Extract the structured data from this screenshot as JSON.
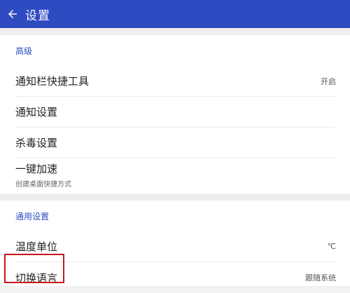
{
  "appbar": {
    "title": "设置",
    "back_icon": "arrow-left-icon",
    "color": "#2e4bc2"
  },
  "advanced": {
    "header": "高级",
    "items": [
      {
        "label": "通知栏快捷工具",
        "value": "开启"
      },
      {
        "label": "通知设置"
      },
      {
        "label": "杀毒设置"
      },
      {
        "label": "一键加速",
        "subtitle": "创建桌面快捷方式"
      }
    ]
  },
  "general": {
    "header": "通用设置",
    "items": [
      {
        "label": "温度单位",
        "value": "℃"
      },
      {
        "label": "切换语言",
        "value": "跟随系统"
      }
    ]
  },
  "highlight_color": "#c8161e"
}
